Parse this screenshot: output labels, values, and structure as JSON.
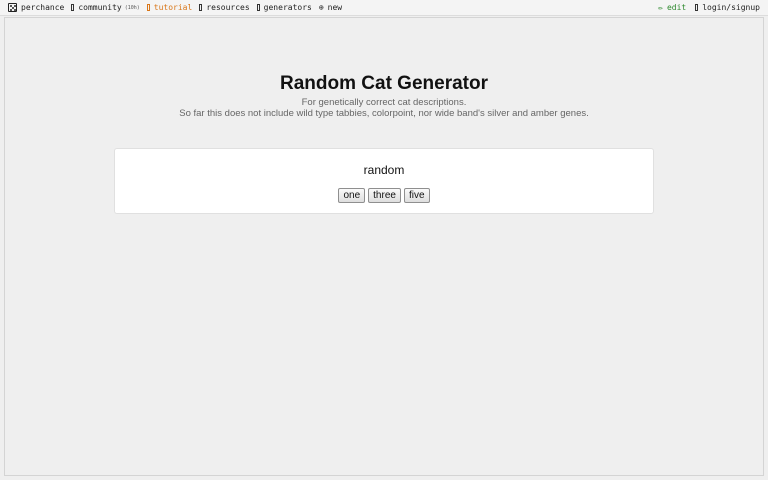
{
  "nav": {
    "left": [
      {
        "label": "perchance",
        "icon": "die-icon"
      },
      {
        "label": "community",
        "count": "(10h)",
        "icon": "chat-icon"
      },
      {
        "label": "tutorial",
        "icon": "book-icon",
        "accent": "#d9771a"
      },
      {
        "label": "resources",
        "icon": "doc-icon"
      },
      {
        "label": "generators",
        "icon": "doc-icon"
      },
      {
        "label": "new",
        "icon": "plus-circle-icon"
      }
    ],
    "right": [
      {
        "label": "edit",
        "icon": "pencil-icon",
        "color": "#2f8a2f"
      },
      {
        "label": "login/signup",
        "icon": "user-icon"
      }
    ]
  },
  "page": {
    "title": "Random Cat Generator",
    "subtitle": "For genetically correct cat descriptions.",
    "note": "So far this does not include wild type tabbies, colorpoint, nor wide band's silver and amber genes."
  },
  "generator": {
    "output": "random",
    "buttons": [
      "one",
      "three",
      "five"
    ]
  }
}
